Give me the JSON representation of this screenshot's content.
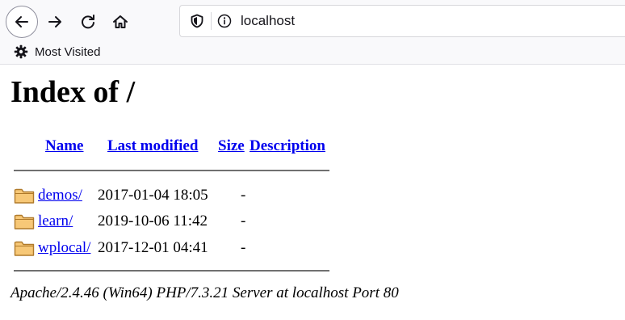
{
  "browser": {
    "url": "localhost",
    "bookmarks": [
      {
        "label": "Most Visited",
        "icon": "gear-icon"
      }
    ],
    "nav_icons": [
      "back-arrow-icon",
      "forward-arrow-icon",
      "reload-icon",
      "home-icon"
    ],
    "url_icons": [
      "shield-icon",
      "info-icon"
    ]
  },
  "page": {
    "title": "Index of /",
    "columns": {
      "name": "Name",
      "last_modified": "Last modified",
      "size": "Size",
      "description": "Description"
    },
    "rows": [
      {
        "name": "demos/",
        "modified": "2017-01-04 18:05",
        "size": "-",
        "description": "",
        "icon": "folder-icon"
      },
      {
        "name": "learn/",
        "modified": "2019-10-06 11:42",
        "size": "-",
        "description": "",
        "icon": "folder-icon"
      },
      {
        "name": "wplocal/",
        "modified": "2017-12-01 04:41",
        "size": "-",
        "description": "",
        "icon": "folder-icon"
      }
    ],
    "address": "Apache/2.4.46 (Win64) PHP/7.3.21 Server at localhost Port 80"
  },
  "colors": {
    "link": "#0000ee",
    "folder_fill": "#f7c877",
    "folder_stroke": "#b07a2a",
    "toolbar_bg": "#f9f9fb"
  }
}
